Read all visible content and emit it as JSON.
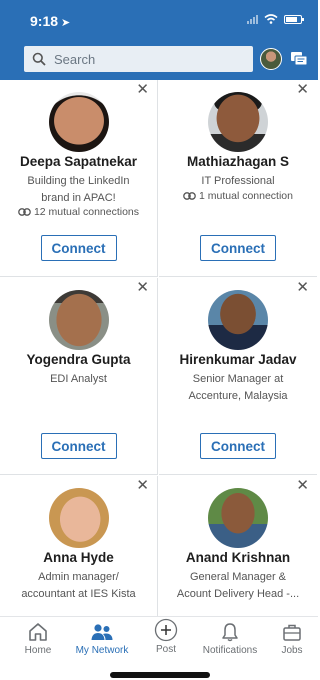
{
  "status_bar": {
    "time": "9:18"
  },
  "search": {
    "placeholder": "Search"
  },
  "cards": [
    {
      "name": "Deepa Sapatnekar",
      "headline_line1": "Building the LinkedIn",
      "headline_line2": "brand in APAC!",
      "mutual": "12 mutual connections",
      "button": "Connect"
    },
    {
      "name": "Mathiazhagan S",
      "headline_line1": "IT Professional",
      "headline_line2": "",
      "mutual": "1 mutual connection",
      "button": "Connect"
    },
    {
      "name": "Yogendra Gupta",
      "headline_line1": "EDI Analyst",
      "headline_line2": "",
      "mutual": "",
      "button": "Connect"
    },
    {
      "name": "Hirenkumar Jadav",
      "headline_line1": "Senior Manager at",
      "headline_line2": "Accenture, Malaysia",
      "mutual": "",
      "button": "Connect"
    },
    {
      "name": "Anna Hyde",
      "headline_line1": "Admin manager/",
      "headline_line2": "accountant at IES Kista",
      "mutual": "",
      "button": ""
    },
    {
      "name": "Anand Krishnan",
      "headline_line1": "General Manager &",
      "headline_line2": "Acount Delivery Head -...",
      "mutual": "",
      "button": ""
    }
  ],
  "bottom_nav": {
    "home": "Home",
    "network": "My Network",
    "post": "Post",
    "notifications": "Notifications",
    "jobs": "Jobs"
  },
  "colors": {
    "brand": "#2a6fb6",
    "nav_active": "#2a6fb6"
  }
}
